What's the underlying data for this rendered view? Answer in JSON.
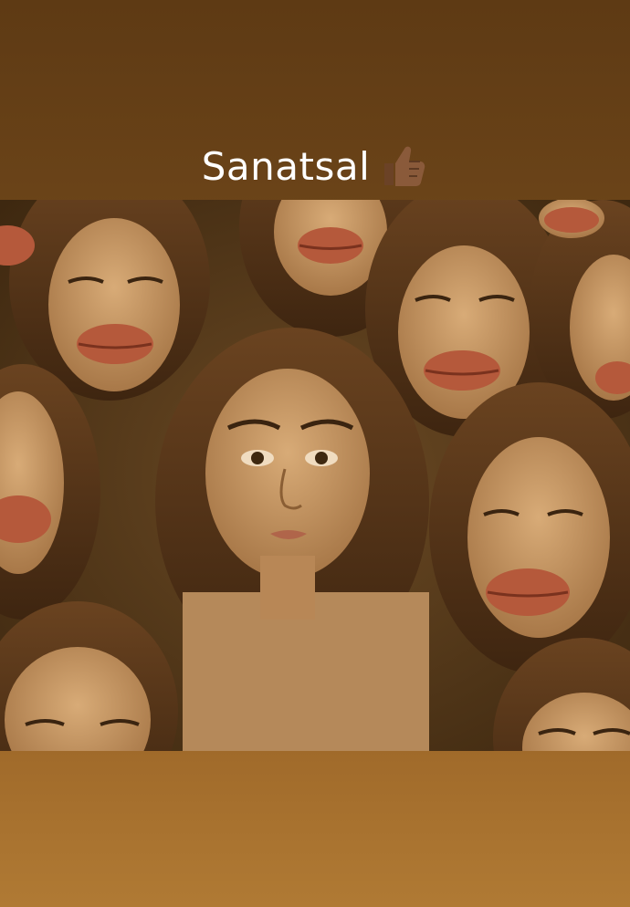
{
  "story": {
    "caption": "Sanatsal",
    "caption_emoji": "thumbs-up-icon",
    "caption_text_color": "#ffffff",
    "background_top_color": "#5e3a14",
    "background_bottom_color": "#b07a34"
  },
  "artwork": {
    "subject": "painting-icon",
    "palette": {
      "background": "#5a3c1c",
      "skin": "#c99a66",
      "hair": "#5a3719",
      "lips": "#b5593b",
      "shadow": "#3e2810"
    }
  }
}
